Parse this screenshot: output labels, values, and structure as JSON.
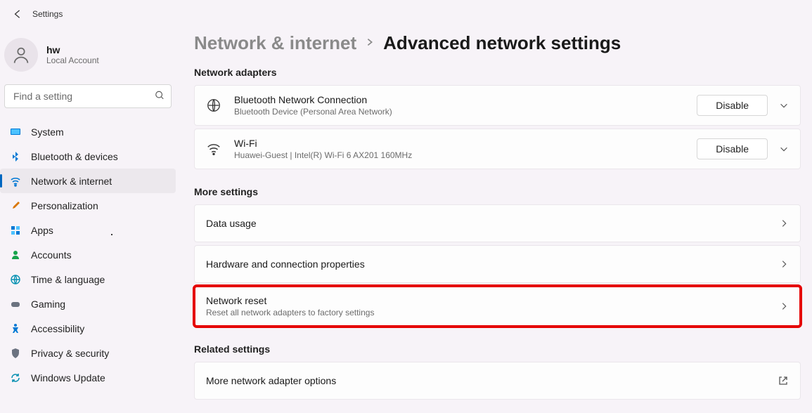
{
  "app": {
    "title": "Settings"
  },
  "user": {
    "name": "hw",
    "subtitle": "Local Account"
  },
  "search": {
    "placeholder": "Find a setting"
  },
  "sidebar": {
    "items": [
      {
        "label": "System"
      },
      {
        "label": "Bluetooth & devices"
      },
      {
        "label": "Network & internet"
      },
      {
        "label": "Personalization"
      },
      {
        "label": "Apps"
      },
      {
        "label": "Accounts"
      },
      {
        "label": "Time & language"
      },
      {
        "label": "Gaming"
      },
      {
        "label": "Accessibility"
      },
      {
        "label": "Privacy & security"
      },
      {
        "label": "Windows Update"
      }
    ]
  },
  "breadcrumb": {
    "parent": "Network & internet",
    "current": "Advanced network settings"
  },
  "sections": {
    "adapters_title": "Network adapters",
    "more_title": "More settings",
    "related_title": "Related settings"
  },
  "adapters": [
    {
      "title": "Bluetooth Network Connection",
      "subtitle": "Bluetooth Device (Personal Area Network)",
      "action": "Disable"
    },
    {
      "title": "Wi-Fi",
      "subtitle": "Huawei-Guest | Intel(R) Wi-Fi 6 AX201 160MHz",
      "action": "Disable"
    }
  ],
  "more_settings": [
    {
      "title": "Data usage"
    },
    {
      "title": "Hardware and connection properties"
    },
    {
      "title": "Network reset",
      "subtitle": "Reset all network adapters to factory settings",
      "highlighted": true
    }
  ],
  "related_settings": [
    {
      "title": "More network adapter options"
    }
  ]
}
